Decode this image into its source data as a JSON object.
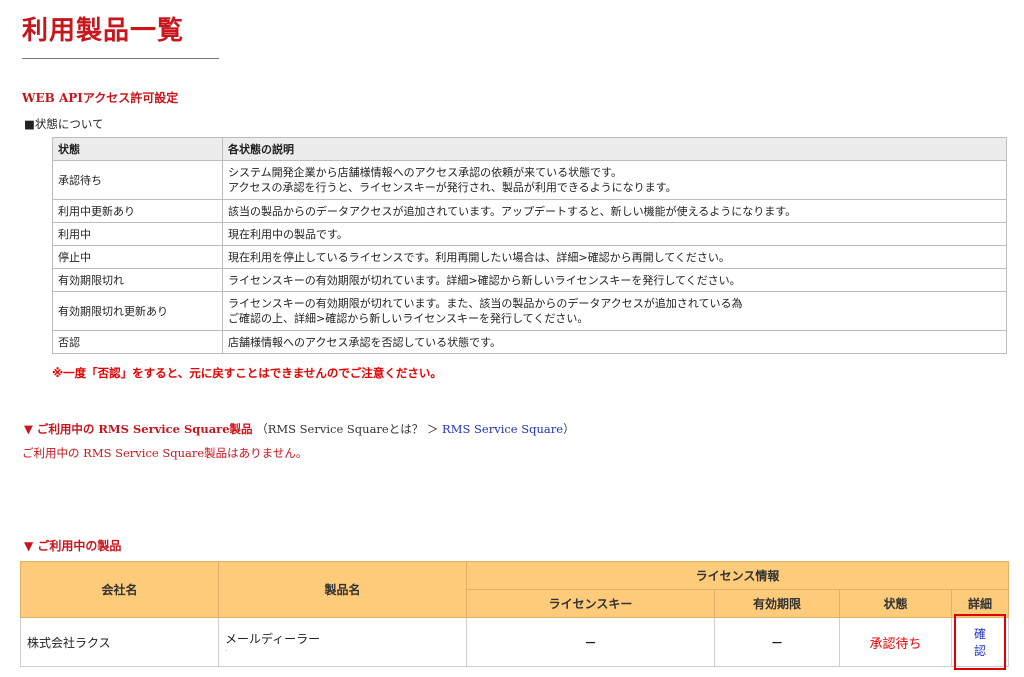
{
  "page_title": "利用製品一覧",
  "webapi_section": "WEB APIアクセス許可設定",
  "status_about": "■状態について",
  "status_table": {
    "headers": [
      "状態",
      "各状態の説明"
    ],
    "rows": [
      {
        "state": "承認待ち",
        "desc": [
          "システム開発企業から店舗様情報へのアクセス承認の依頼が来ている状態です。",
          "アクセスの承認を行うと、ライセンスキーが発行され、製品が利用できるようになります。"
        ]
      },
      {
        "state": "利用中更新あり",
        "desc": [
          "該当の製品からのデータアクセスが追加されています。アップデートすると、新しい機能が使えるようになります。"
        ]
      },
      {
        "state": "利用中",
        "desc": [
          "現在利用中の製品です。"
        ]
      },
      {
        "state": "停止中",
        "desc": [
          "現在利用を停止しているライセンスです。利用再開したい場合は、詳細>確認から再開してください。"
        ]
      },
      {
        "state": "有効期限切れ",
        "desc": [
          "ライセンスキーの有効期限が切れています。詳細>確認から新しいライセンスキーを発行してください。"
        ]
      },
      {
        "state": "有効期限切れ更新あり",
        "desc": [
          "ライセンスキーの有効期限が切れています。また、該当の製品からのデータアクセスが追加されている為",
          "ご確認の上、詳細>確認から新しいライセンスキーを発行してください。"
        ]
      },
      {
        "state": "否認",
        "desc": [
          "店舗様情報へのアクセス承認を否認している状態です。"
        ]
      }
    ]
  },
  "warning": "※一度「否認」をすると、元に戻すことはできませんのでご注意ください。",
  "rms": {
    "heading": "▼ ご利用中の RMS Service Square製品",
    "paren_open": "（RMS Service Squareとは？ ＞ ",
    "link": "RMS Service Square",
    "paren_close": "）",
    "none_text": "ご利用中の RMS Service Square製品はありません。"
  },
  "products": {
    "heading": "▼ ご利用中の製品",
    "headers": {
      "company": "会社名",
      "product": "製品名",
      "license_info": "ライセンス情報",
      "license_key": "ライセンスキー",
      "expiry": "有効期限",
      "status": "状態",
      "detail": "詳細"
    },
    "rows": [
      {
        "company": "株式会社ラクス",
        "product": "メールディーラー",
        "product_sub": "-",
        "license_key": "－",
        "expiry": "－",
        "status": "承認待ち",
        "detail": "確認"
      }
    ]
  },
  "colors": {
    "accent_red": "#c8161d",
    "header_orange": "#fdcb7a",
    "link_blue": "#2233cc"
  }
}
